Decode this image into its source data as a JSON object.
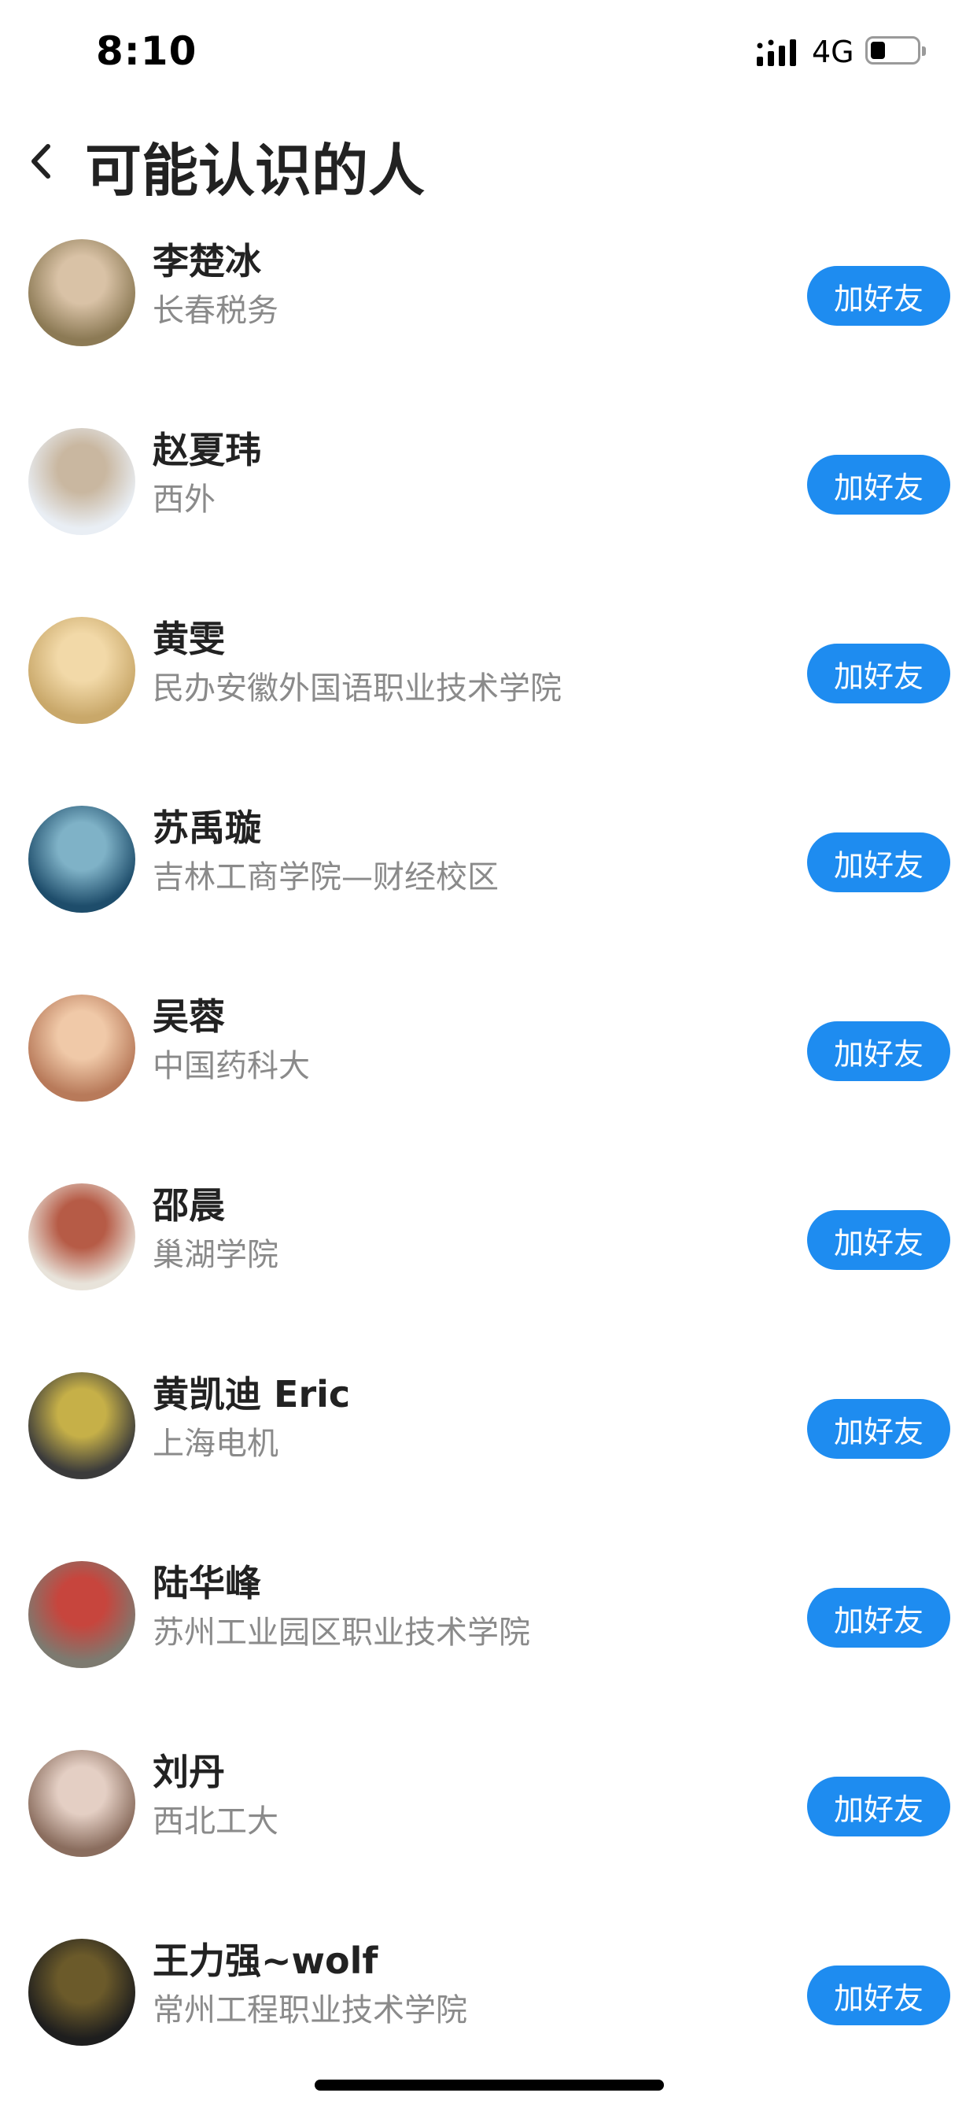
{
  "status": {
    "time": "8:10",
    "network": "4G"
  },
  "header": {
    "title": "可能认识的人"
  },
  "people": [
    {
      "name": "李楚冰",
      "org": "长春税务",
      "action": "加好友",
      "avatar_colors": [
        "#8c7a55",
        "#d9c2a6"
      ]
    },
    {
      "name": "赵夏玮",
      "org": "西外",
      "action": "加好友",
      "avatar_colors": [
        "#e9eef4",
        "#c9b7a0"
      ]
    },
    {
      "name": "黄雯",
      "org": "民办安徽外国语职业技术学院",
      "action": "加好友",
      "avatar_colors": [
        "#c9a86a",
        "#f2d9a8"
      ]
    },
    {
      "name": "苏禹璇",
      "org": "吉林工商学院—财经校区",
      "action": "加好友",
      "avatar_colors": [
        "#1e4d6b",
        "#7fb2c7"
      ]
    },
    {
      "name": "吴蓉",
      "org": "中国药科大",
      "action": "加好友",
      "avatar_colors": [
        "#b87a5a",
        "#f0c9a8"
      ]
    },
    {
      "name": "邵晨",
      "org": "巢湖学院",
      "action": "加好友",
      "avatar_colors": [
        "#e8e3da",
        "#b65b46"
      ]
    },
    {
      "name": "黄凯迪 Eric",
      "org": "上海电机",
      "action": "加好友",
      "avatar_colors": [
        "#3b3b3b",
        "#c6b048"
      ]
    },
    {
      "name": "陆华峰",
      "org": "苏州工业园区职业技术学院",
      "action": "加好友",
      "avatar_colors": [
        "#7d7a70",
        "#c7453d"
      ]
    },
    {
      "name": "刘丹",
      "org": "西北工大",
      "action": "加好友",
      "avatar_colors": [
        "#8a6d5e",
        "#e4cfc4"
      ]
    },
    {
      "name": "王力强~wolf",
      "org": "常州工程职业技术学院",
      "action": "加好友",
      "avatar_colors": [
        "#1e1e1e",
        "#6b5a2a"
      ]
    }
  ]
}
